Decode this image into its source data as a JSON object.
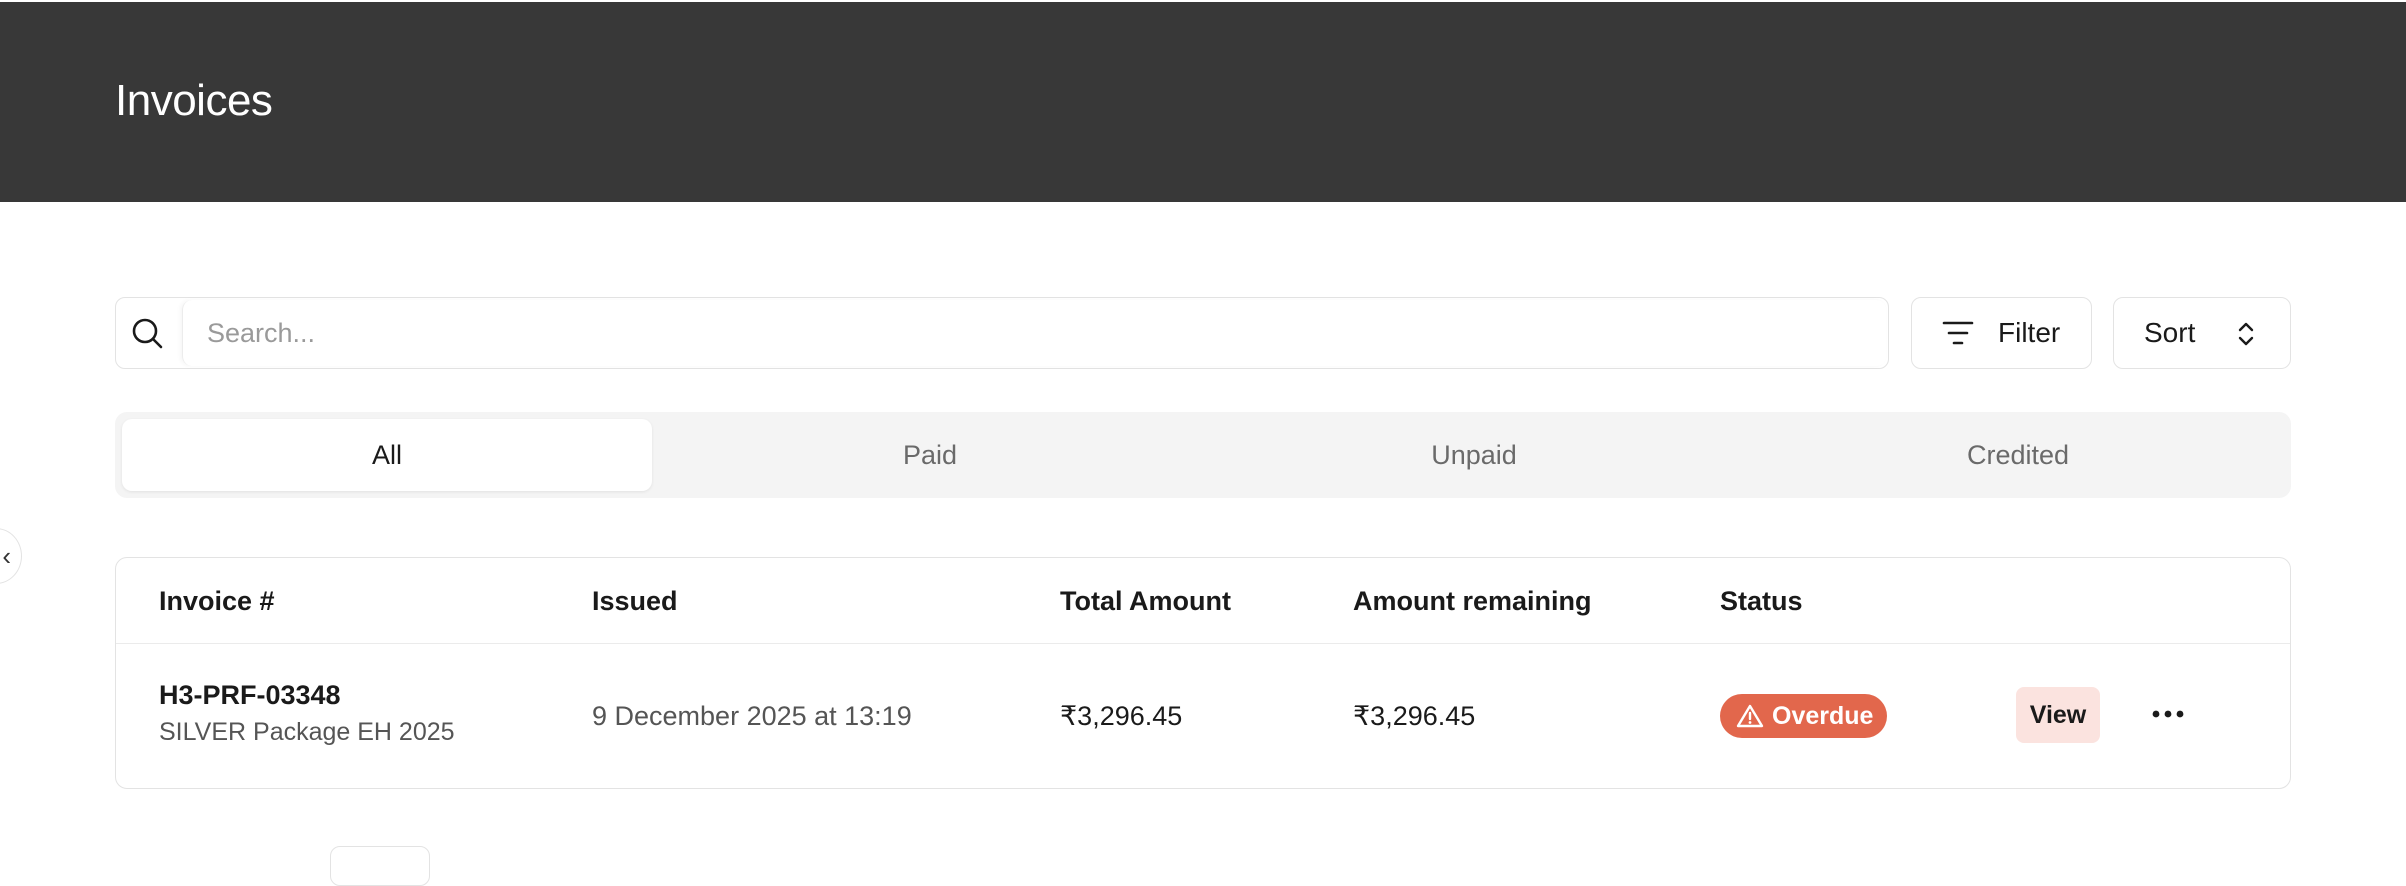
{
  "header": {
    "title": "Invoices"
  },
  "search": {
    "placeholder": "Search...",
    "value": ""
  },
  "toolbar": {
    "filter_label": "Filter",
    "sort_label": "Sort"
  },
  "tabs": [
    {
      "label": "All",
      "active": true
    },
    {
      "label": "Paid",
      "active": false
    },
    {
      "label": "Unpaid",
      "active": false
    },
    {
      "label": "Credited",
      "active": false
    }
  ],
  "table": {
    "columns": [
      "Invoice #",
      "Issued",
      "Total Amount",
      "Amount remaining",
      "Status"
    ],
    "rows": [
      {
        "invoice_number": "H3-PRF-03348",
        "description": "SILVER Package EH 2025",
        "issued": "9 December 2025 at 13:19",
        "total_amount": "₹3,296.45",
        "amount_remaining": "₹3,296.45",
        "status": "Overdue",
        "action_label": "View"
      }
    ]
  },
  "colors": {
    "header_bg": "#383838",
    "status_overdue": "#e2674c",
    "view_button_bg": "#fbe3df"
  },
  "icons": [
    "search-icon",
    "filter-icon",
    "sort-icon",
    "warning-icon",
    "more-icon",
    "chevron-left-icon"
  ]
}
